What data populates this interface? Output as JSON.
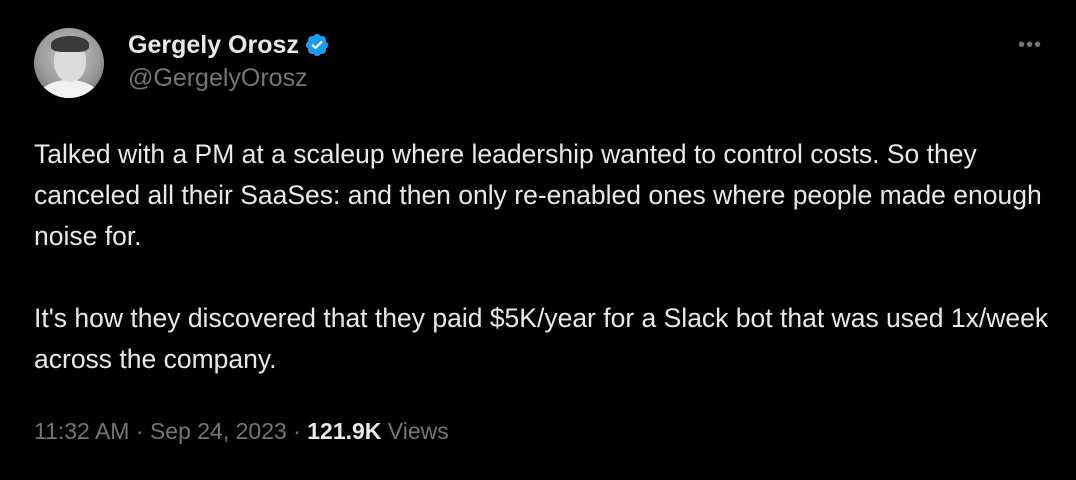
{
  "author": {
    "display_name": "Gergely Orosz",
    "handle": "@GergelyOrosz",
    "verified": true
  },
  "tweet": {
    "paragraphs": [
      "Talked with a PM at a scaleup where leadership wanted to control costs. So they canceled all their SaaSes: and then only re-enabled ones where people made enough noise for.",
      "It's how they discovered that they paid $5K/year for a Slack bot that was used 1x/week across the company."
    ]
  },
  "meta": {
    "time": "11:32 AM",
    "separator": " · ",
    "date": "Sep 24, 2023",
    "views_count": "121.9K",
    "views_label": " Views"
  },
  "icons": {
    "more": "more-options-icon",
    "verified": "verified-badge-icon"
  },
  "colors": {
    "background": "#000000",
    "text": "#e7e9ea",
    "muted": "#71767b",
    "verified_blue": "#1d9bf0"
  }
}
